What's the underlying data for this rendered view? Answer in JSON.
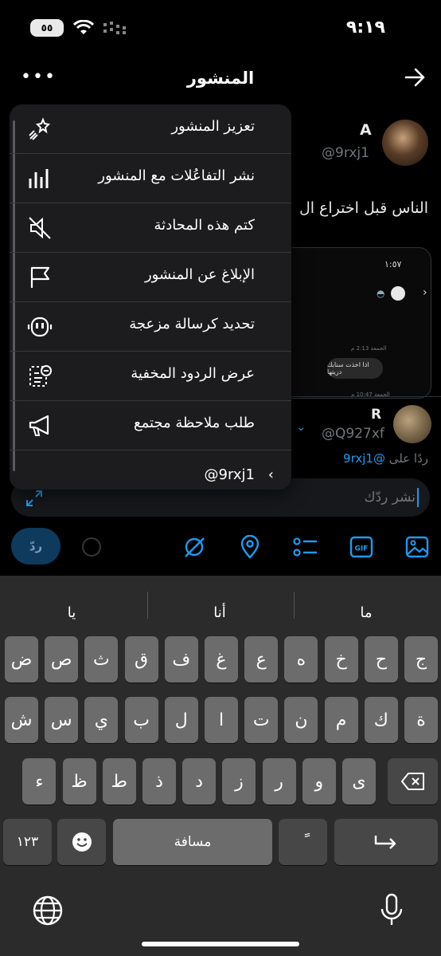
{
  "status_bar": {
    "time": "٩:١٩",
    "battery_text": "٥٥"
  },
  "header": {
    "title": "المنشور"
  },
  "post": {
    "author_name": "A",
    "author_handle": "@9rxj1",
    "text": "الناس قبل اختراع ال",
    "media": {
      "time": "١:٥٧",
      "bubble_text": "اذا اخذت سنابك دزيتها",
      "timestamp_top": "الجمعة 2:13 م",
      "timestamp_bottom": "الجمعة 10:47 م"
    }
  },
  "reply": {
    "author_name": "R",
    "author_handle": "@Q927xf",
    "replying_to_prefix": "ردًا على",
    "replying_to_handle": "@9rxj1"
  },
  "compose": {
    "placeholder": "نشر ردّك",
    "reply_button": "ردّ"
  },
  "menu": {
    "items": [
      {
        "label": "تعزيز المنشور",
        "icon": "boost-icon"
      },
      {
        "label": "نشر التفاعُلات مع المنشور",
        "icon": "analytics-icon"
      },
      {
        "label": "كتم هذه المحادثة",
        "icon": "mute-icon"
      },
      {
        "label": "الإبلاغ عن المنشور",
        "icon": "flag-icon"
      },
      {
        "label": "تحديد كرسالة مزعجة",
        "icon": "robot-icon"
      },
      {
        "label": "عرض الردود المخفية",
        "icon": "hidden-replies-icon"
      },
      {
        "label": "طلب ملاحظة مجتمع",
        "icon": "megaphone-icon"
      }
    ],
    "footer_handle": "@9rxj1"
  },
  "keyboard": {
    "suggestions": [
      "ما",
      "أنا",
      "يا"
    ],
    "row1": [
      "ج",
      "ح",
      "خ",
      "ه",
      "ع",
      "غ",
      "ف",
      "ق",
      "ث",
      "ص",
      "ض"
    ],
    "row2": [
      "ة",
      "ك",
      "م",
      "ن",
      "ت",
      "ا",
      "ل",
      "ب",
      "ي",
      "س",
      "ش"
    ],
    "row3": [
      "ى",
      "و",
      "ر",
      "ز",
      "د",
      "ذ",
      "ط",
      "ظ",
      "ء"
    ],
    "numbers_key": "١٢٣",
    "space_key": "مسافة",
    "diacritic_key": "ً"
  },
  "colors": {
    "accent": "#1d9bf0",
    "menu_bg": "#1c1c1e",
    "keyboard_bg": "#2b2b2b"
  }
}
